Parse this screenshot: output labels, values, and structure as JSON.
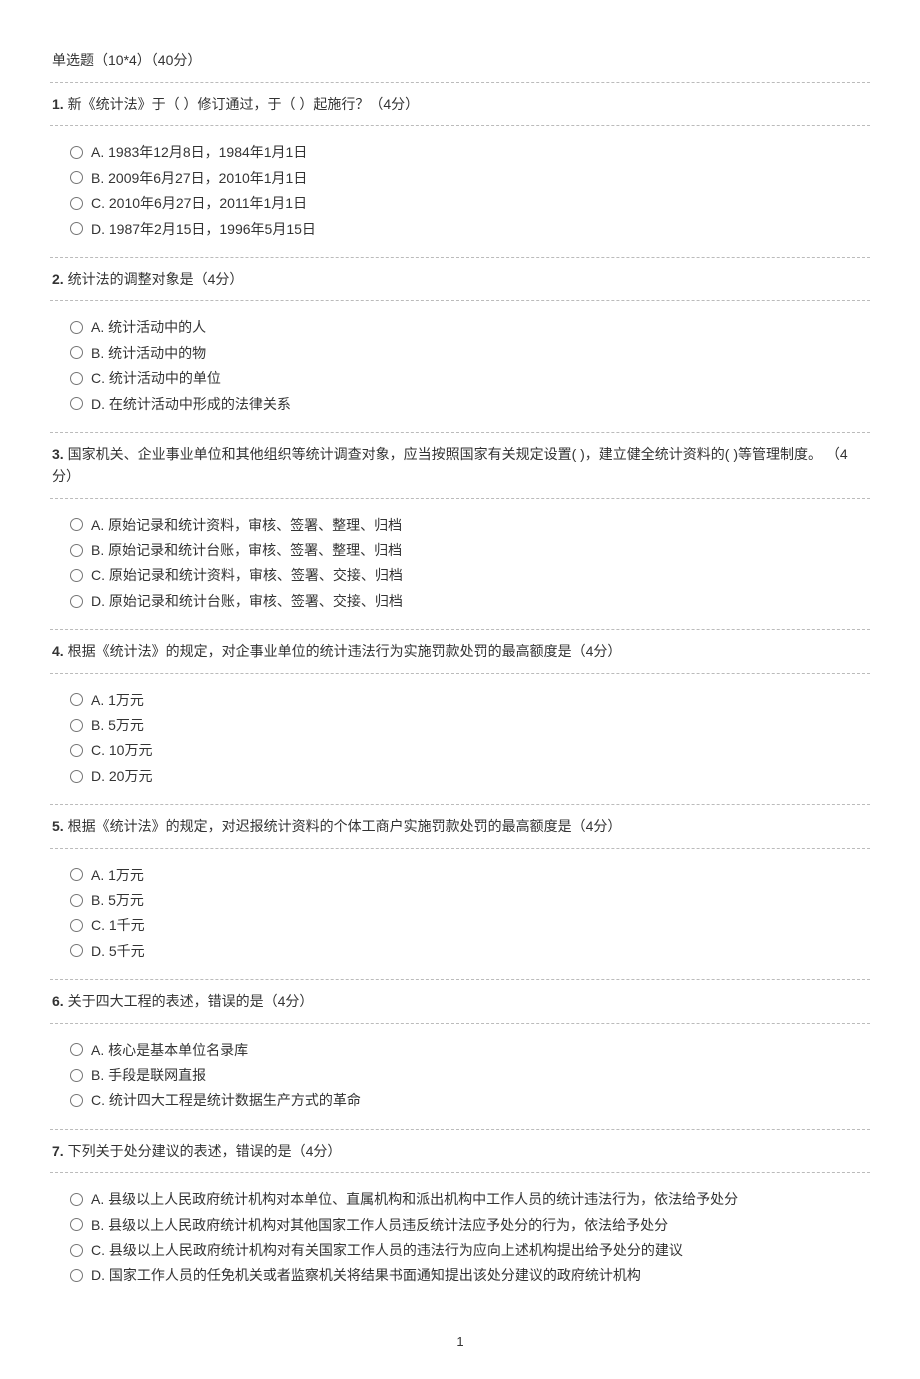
{
  "section_title": "单选题（10*4）（40分）",
  "questions": [
    {
      "num": "1.",
      "text": " 新《统计法》于（ ）修订通过，于（ ）起施行？（4分）",
      "options": [
        "A. 1983年12月8日，1984年1月1日",
        "B. 2009年6月27日，2010年1月1日",
        "C. 2010年6月27日，2011年1月1日",
        "D. 1987年2月15日，1996年5月15日"
      ]
    },
    {
      "num": "2.",
      "text": " 统计法的调整对象是（4分）",
      "options": [
        "A. 统计活动中的人",
        "B. 统计活动中的物",
        "C. 统计活动中的单位",
        "D. 在统计活动中形成的法律关系"
      ]
    },
    {
      "num": "3.",
      "text": " 国家机关、企业事业单位和其他组织等统计调查对象，应当按照国家有关规定设置( )，建立健全统计资料的( )等管理制度。 （4分）",
      "options": [
        "A. 原始记录和统计资料，审核、签署、整理、归档",
        "B. 原始记录和统计台账，审核、签署、整理、归档",
        "C. 原始记录和统计资料，审核、签署、交接、归档",
        "D. 原始记录和统计台账，审核、签署、交接、归档"
      ]
    },
    {
      "num": "4.",
      "text": " 根据《统计法》的规定，对企事业单位的统计违法行为实施罚款处罚的最高额度是（4分）",
      "options": [
        "A. 1万元",
        "B. 5万元",
        "C. 10万元",
        "D. 20万元"
      ]
    },
    {
      "num": "5.",
      "text": " 根据《统计法》的规定，对迟报统计资料的个体工商户实施罚款处罚的最高额度是（4分）",
      "options": [
        "A. 1万元",
        "B. 5万元",
        "C. 1千元",
        "D. 5千元"
      ]
    },
    {
      "num": "6.",
      "text": " 关于四大工程的表述，错误的是（4分）",
      "options": [
        "A. 核心是基本单位名录库",
        "B. 手段是联网直报",
        "C. 统计四大工程是统计数据生产方式的革命"
      ]
    },
    {
      "num": "7.",
      "text": " 下列关于处分建议的表述，错误的是（4分）",
      "options": [
        "A. 县级以上人民政府统计机构对本单位、直属机构和派出机构中工作人员的统计违法行为，依法给予处分",
        "B. 县级以上人民政府统计机构对其他国家工作人员违反统计法应予处分的行为，依法给予处分",
        "C. 县级以上人民政府统计机构对有关国家工作人员的违法行为应向上述机构提出给予处分的建议",
        "D. 国家工作人员的任免机关或者监察机关将结果书面通知提出该处分建议的政府统计机构"
      ]
    }
  ],
  "page_number": "1"
}
